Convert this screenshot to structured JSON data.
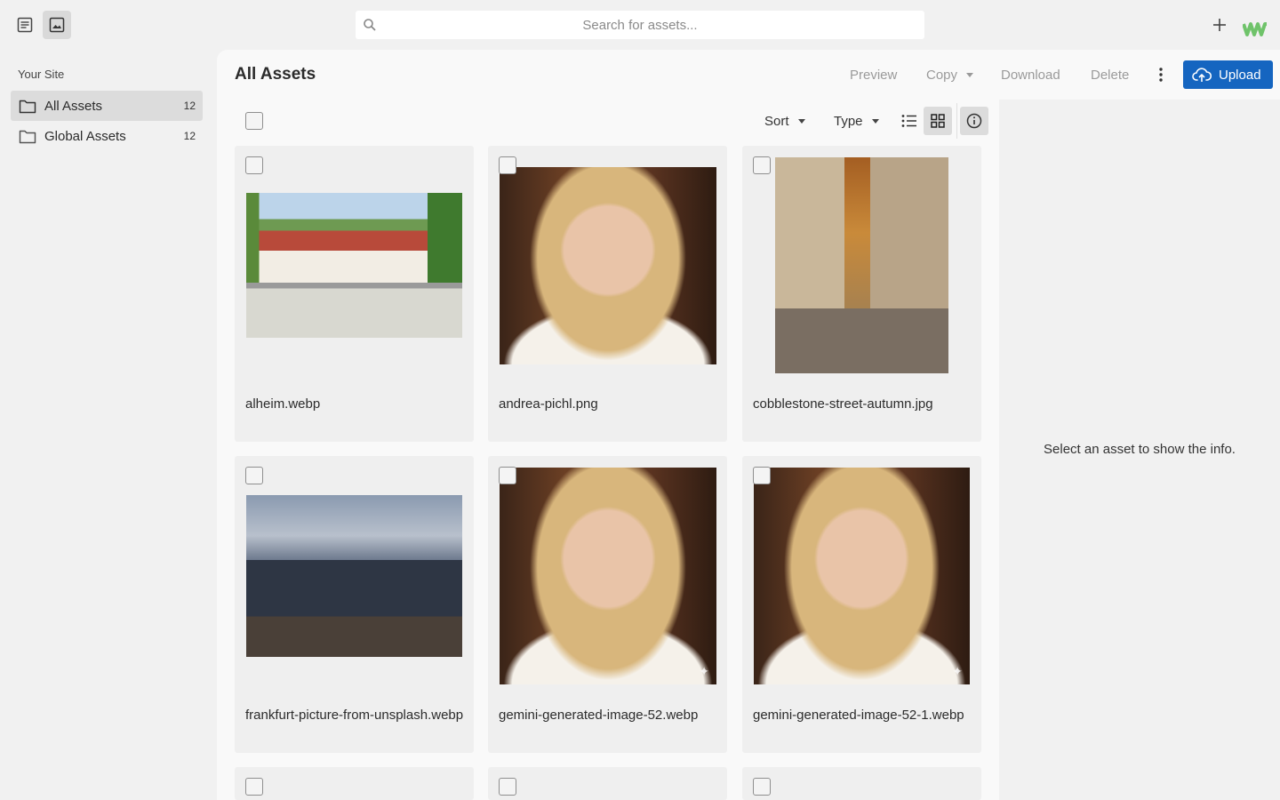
{
  "topbar": {
    "search_placeholder": "Search for assets..."
  },
  "sidebar": {
    "site_label": "Your Site",
    "items": [
      {
        "label": "All Assets",
        "count": "12"
      },
      {
        "label": "Global Assets",
        "count": "12"
      }
    ]
  },
  "main": {
    "title": "All Assets",
    "actions": {
      "preview": "Preview",
      "copy": "Copy",
      "download": "Download",
      "delete": "Delete",
      "upload": "Upload"
    },
    "toolbar": {
      "sort": "Sort",
      "type": "Type"
    },
    "info_message": "Select an asset to show the info."
  },
  "assets": [
    {
      "filename": "alheim.webp"
    },
    {
      "filename": "andrea-pichl.png"
    },
    {
      "filename": "cobblestone-street-autumn.jpg"
    },
    {
      "filename": "frankfurt-picture-from-unsplash.webp"
    },
    {
      "filename": "gemini-generated-image-52.webp"
    },
    {
      "filename": "gemini-generated-image-52-1.webp"
    }
  ],
  "colors": {
    "accent": "#1565c0",
    "logo": "#6fc36a"
  }
}
